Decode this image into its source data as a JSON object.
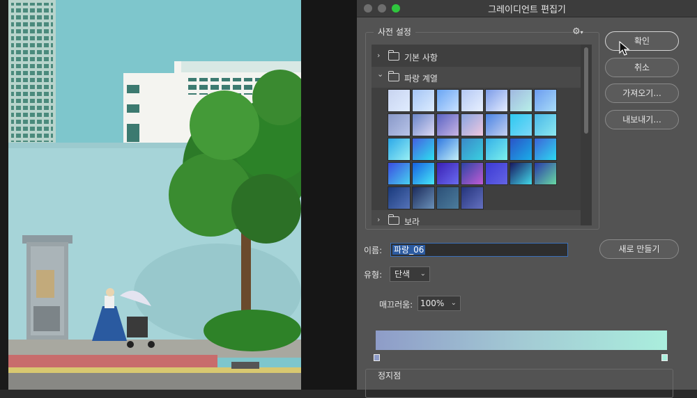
{
  "dialog": {
    "title": "그레이디언트 편집기",
    "presets": {
      "label": "사전 설정",
      "folders": [
        {
          "label": "기본 사항",
          "expanded": false,
          "chevron": "›"
        },
        {
          "label": "파랑 계열",
          "expanded": true,
          "chevron": "⌄"
        },
        {
          "label": "보라",
          "expanded": false,
          "chevron": "›"
        }
      ],
      "swatches": [
        [
          "#c8d4f0",
          "#e0ecff"
        ],
        [
          "#a4c4f4",
          "#dcecff"
        ],
        [
          "#6aa6f4",
          "#c8e0ff"
        ],
        [
          "#b4c8f4",
          "#e8f0ff"
        ],
        [
          "#7c9ce8",
          "#e4ecff"
        ],
        [
          "#a0b8e0",
          "#b8f0e8"
        ],
        [
          "#6c9cf0",
          "#a8dcf8"
        ],
        [
          "#8898c8",
          "#b8c4e8"
        ],
        [
          "#6a86c8",
          "#dcd8f4"
        ],
        [
          "#5a64c4",
          "#c8b4e4"
        ],
        [
          "#88a4e0",
          "#f0c8e0"
        ],
        [
          "#4a84e4",
          "#c4d0f0"
        ],
        [
          "#2ec8f0",
          "#7cd8f8"
        ],
        [
          "#4ab8e8",
          "#8ce8f0"
        ],
        [
          "#2ca8e8",
          "#98f0f4"
        ],
        [
          "#4460e0",
          "#2ee0f0"
        ],
        [
          "#3078e0",
          "#c4f0f8"
        ],
        [
          "#3a88c8",
          "#3ad0e0"
        ],
        [
          "#34b0e8",
          "#7cf0ec"
        ],
        [
          "#2a54c8",
          "#1aaee8"
        ],
        [
          "#3c64d8",
          "#2ed8f0"
        ],
        [
          "#3a4ce0",
          "#48d0f0"
        ],
        [
          "#1860e0",
          "#46e8f8"
        ],
        [
          "#3a20b4",
          "#6a6cf0"
        ],
        [
          "#2c44a4",
          "#c05cd4"
        ],
        [
          "#3c3ad4",
          "#6464e4"
        ],
        [
          "#181860",
          "#42d8e8"
        ],
        [
          "#2a3aa8",
          "#68d8a4"
        ],
        [
          "#1a3a7c",
          "#5472b8"
        ],
        [
          "#1c2c5c",
          "#6a90b8"
        ],
        [
          "#2c5078",
          "#4c7c9c"
        ],
        [
          "#24347c",
          "#6470c0"
        ]
      ]
    },
    "buttons": {
      "ok": "확인",
      "cancel": "취소",
      "import": "가져오기...",
      "export": "내보내기...",
      "new": "새로 만들기"
    },
    "name": {
      "label": "이름:",
      "value": "파랑_06"
    },
    "type": {
      "label": "유형:",
      "value": "단색"
    },
    "smoothness": {
      "label": "매끄러움:",
      "value": "100%"
    },
    "gradient": {
      "left_color": "#8e9cc8",
      "right_color": "#aaeedd"
    },
    "stops": {
      "label": "정지점"
    }
  }
}
